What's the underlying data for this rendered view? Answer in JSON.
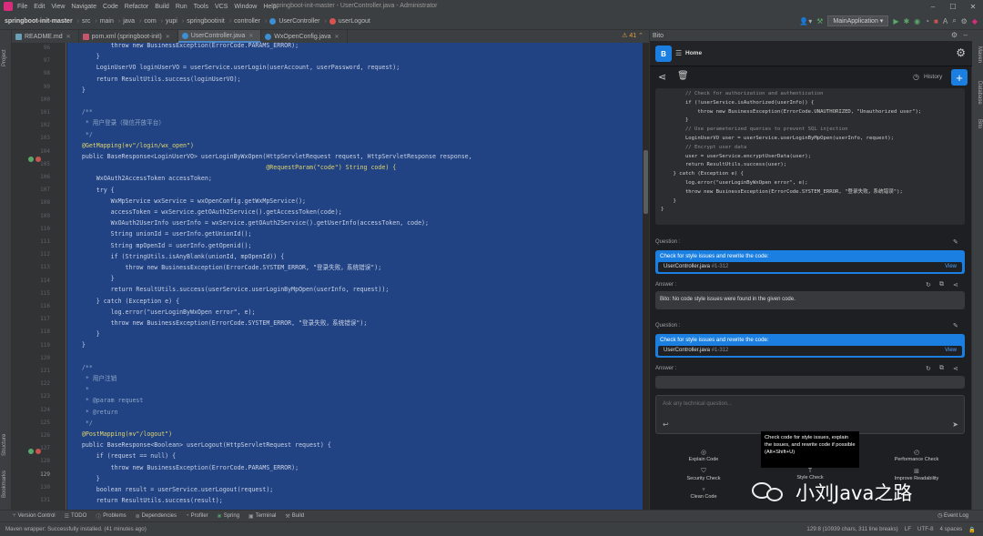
{
  "window": {
    "title": "springboot-init-master - UserController.java - Administrator"
  },
  "menu": [
    "File",
    "Edit",
    "View",
    "Navigate",
    "Code",
    "Refactor",
    "Build",
    "Run",
    "Tools",
    "VCS",
    "Window",
    "Help"
  ],
  "breadcrumbs": [
    "springboot-init-master",
    "src",
    "main",
    "java",
    "com",
    "yupi",
    "springbootinit",
    "controller",
    "UserController",
    "userLogout"
  ],
  "run": {
    "config": "MainApplication"
  },
  "left_tools": [
    "Project",
    "Structure",
    "Bookmarks"
  ],
  "right_tools": [
    "Maven",
    "Database",
    "Bito"
  ],
  "tabs": [
    "README.md",
    "pom.xml (springboot-init)",
    "UserController.java",
    "WxOpenConfig.java"
  ],
  "warnings": "41",
  "gutter": {
    "first_line": 96,
    "last_line": 131,
    "current_line": 129
  },
  "code_lines": [
    "            throw new BusinessException(ErrorCode.PARAMS_ERROR);",
    "        }",
    "        LoginUserVO loginUserVO = userService.userLogin(userAccount, userPassword, request);",
    "        return ResultUtils.success(loginUserVO);",
    "    }",
    "",
    "    /**",
    "     * 用户登录（微信开放平台）",
    "     */",
    "    @GetMapping(⊕∨\"/login/wx_open\")",
    "    public BaseResponse<LoginUserVO> userLoginByWxOpen(HttpServletRequest request, HttpServletResponse response,",
    "                                                       @RequestParam(\"code\") String code) {",
    "        WxOAuth2AccessToken accessToken;",
    "        try {",
    "            WxMpService wxService = wxOpenConfig.getWxMpService();",
    "            accessToken = wxService.getOAuth2Service().getAccessToken(code);",
    "            WxOAuth2UserInfo userInfo = wxService.getOAuth2Service().getUserInfo(accessToken, code);",
    "            String unionId = userInfo.getUnionId();",
    "            String mpOpenId = userInfo.getOpenid();",
    "            if (StringUtils.isAnyBlank(unionId, mpOpenId)) {",
    "                throw new BusinessException(ErrorCode.SYSTEM_ERROR, \"登录失败，系统错误\");",
    "            }",
    "            return ResultUtils.success(userService.userLoginByMpOpen(userInfo, request));",
    "        } catch (Exception e) {",
    "            log.error(\"userLoginByWxOpen error\", e);",
    "            throw new BusinessException(ErrorCode.SYSTEM_ERROR, \"登录失败，系统错误\");",
    "        }",
    "    }",
    "",
    "    /**",
    "     * 用户注销",
    "     *",
    "     * @param request",
    "     * @return",
    "     */",
    "    @PostMapping(⊕∨\"/logout\")",
    "    public BaseResponse<Boolean> userLogout(HttpServletRequest request) {",
    "        if (request == null) {",
    "            throw new BusinessException(ErrorCode.PARAMS_ERROR);",
    "        }",
    "        boolean result = userService.userLogout(request);",
    "        return ResultUtils.success(result);"
  ],
  "bito": {
    "panel_title": "Bito",
    "home": "Home",
    "history": "History",
    "code_lines": [
      "        // Check for authorization and authentication",
      "        if (!userService.isAuthorized(userInfo)) {",
      "            throw new BusinessException(ErrorCode.UNAUTHORIZED, \"Unauthorized user\");",
      "        }",
      "        // Use parameterized queries to prevent SQL injection",
      "        LoginUserVO user = userService.userLoginByMpOpen(userInfo, request);",
      "        // Encrypt user data",
      "        user = userService.encryptUserData(user);",
      "        return ResultUtils.success(user);",
      "    } catch (Exception e) {",
      "        log.error(\"userLoginByWxOpen error\", e);",
      "        throw new BusinessException(ErrorCode.SYSTEM_ERROR, \"登录失败，系统错误\");",
      "    }",
      "}"
    ],
    "question_label": "Question :",
    "answer_label": "Answer :",
    "q1": {
      "text": "Check for style issues and rewrite the code:",
      "file": "UserController.java",
      "lines": "#1-312",
      "view": "View"
    },
    "a1": "Bito: No code style issues were found in the given code.",
    "q2": {
      "text": "Check for style issues and rewrite the code:",
      "file": "UserController.java",
      "lines": "#1-312",
      "view": "View"
    },
    "input_placeholder": "Ask any technical question...",
    "quick_actions": [
      "Explain Code",
      "Security Check",
      "Clean Code",
      "Style Check",
      "Performance Check",
      "Improve Readability"
    ],
    "tooltip": "Check code for style issues, explain the issues, and rewrite code if possible (Alt+Shift+U)"
  },
  "watermark": "小刘Java之路",
  "toolwindows": [
    "Version Control",
    "TODO",
    "Problems",
    "Dependencies",
    "Profiler",
    "Spring",
    "Terminal",
    "Build"
  ],
  "event_log": "Event Log",
  "status": {
    "message": "Maven wrapper: Successfully installed. (41 minutes ago)",
    "position": "129:8 (10939 chars, 311 line breaks)",
    "line_sep": "LF",
    "encoding": "UTF-8",
    "indent": "4 spaces"
  }
}
